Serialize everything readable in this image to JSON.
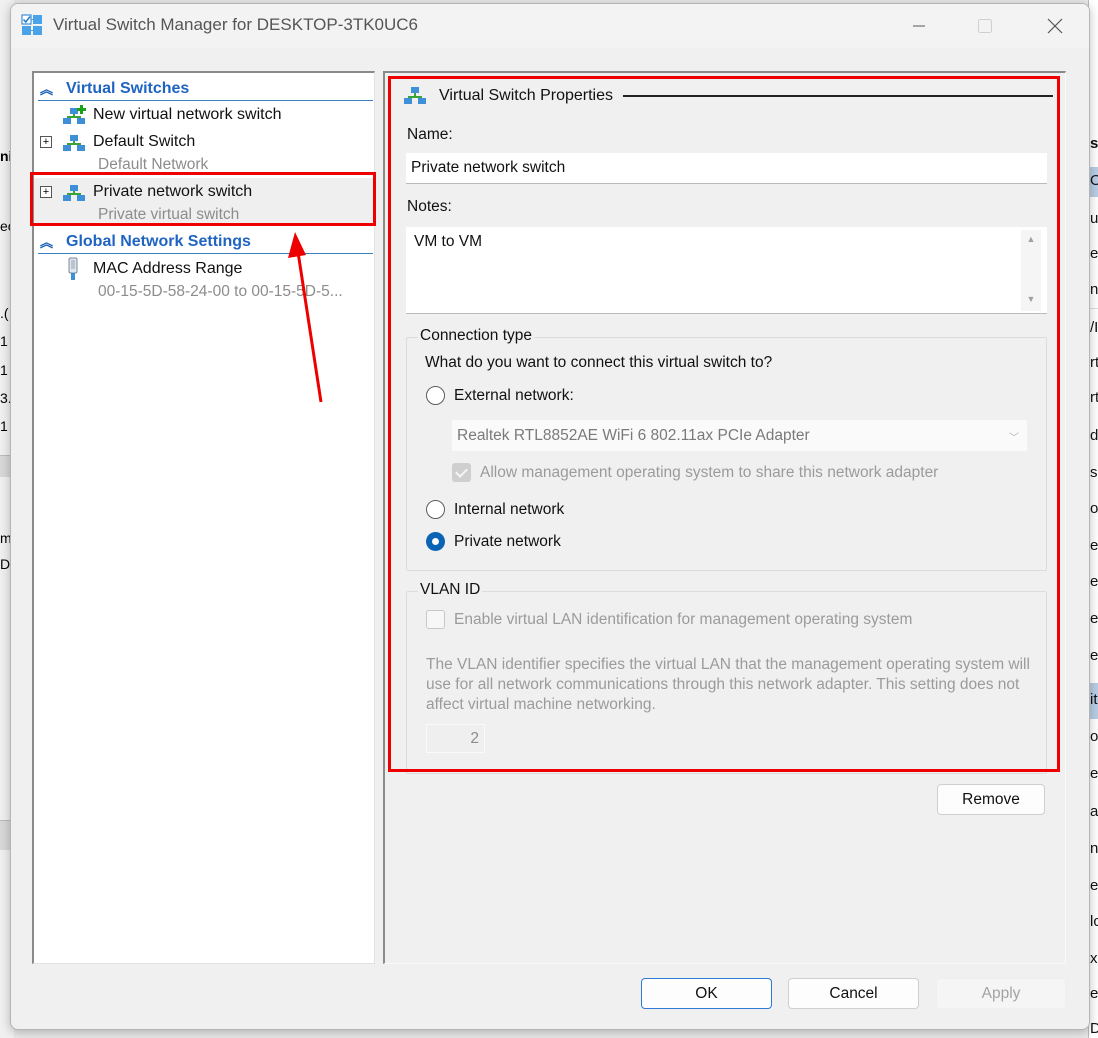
{
  "window": {
    "title": "Virtual Switch Manager for DESKTOP-3TK0UC6",
    "controls": {
      "minimize": "minimize",
      "maximize": "maximize",
      "close": "close"
    }
  },
  "tree": {
    "sections": [
      {
        "label": "Virtual Switches",
        "items": [
          {
            "label": "New virtual network switch",
            "icon": "new-switch-icon"
          },
          {
            "label": "Default Switch",
            "sublabel": "Default Network",
            "icon": "network-switch-icon",
            "expander": "+"
          },
          {
            "label": "Private network switch",
            "sublabel": "Private virtual switch",
            "icon": "network-switch-icon",
            "expander": "+",
            "selected": true
          }
        ]
      },
      {
        "label": "Global Network Settings",
        "items": [
          {
            "label": "MAC Address Range",
            "sublabel": "00-15-5D-58-24-00 to 00-15-5D-5...",
            "icon": "mac-address-icon"
          }
        ]
      }
    ]
  },
  "properties": {
    "header": "Virtual Switch Properties",
    "name_label": "Name:",
    "name_value": "Private network switch",
    "notes_label": "Notes:",
    "notes_value": "VM to VM",
    "connection_type": {
      "title": "Connection type",
      "question": "What do you want to connect this virtual switch to?",
      "options": [
        {
          "label": "External network:",
          "checked": false
        },
        {
          "label": "Internal network",
          "checked": false
        },
        {
          "label": "Private network",
          "checked": true
        }
      ],
      "adapter_selected": "Realtek RTL8852AE WiFi 6 802.11ax PCIe Adapter",
      "allow_management_label": "Allow management operating system to share this network adapter",
      "allow_management_checked": true
    },
    "vlan": {
      "title": "VLAN ID",
      "enable_label": "Enable virtual LAN identification for management operating system",
      "enable_checked": false,
      "description": "The VLAN identifier specifies the virtual LAN that the management operating system will use for all network communications through this network adapter. This setting does not affect virtual machine networking.",
      "value": "2"
    },
    "remove_label": "Remove"
  },
  "footer": {
    "ok_label": "OK",
    "cancel_label": "Cancel",
    "apply_label": "Apply"
  },
  "annotations": {
    "highlight_color": "#ee0000"
  },
  "background": {
    "left_fragments": [
      "ni",
      "ec",
      ".(",
      "1",
      "1",
      "3.",
      "1",
      "m",
      "D"
    ],
    "right_fragments": [
      "s",
      "O",
      "u",
      "e",
      "np",
      "/I",
      "rt",
      "rt",
      "di",
      "s",
      "o",
      "er",
      "ef",
      "e",
      "el",
      "it",
      "or",
      "et",
      "a",
      "ne",
      "ev",
      "lc",
      "xp",
      "er",
      "Del"
    ]
  }
}
